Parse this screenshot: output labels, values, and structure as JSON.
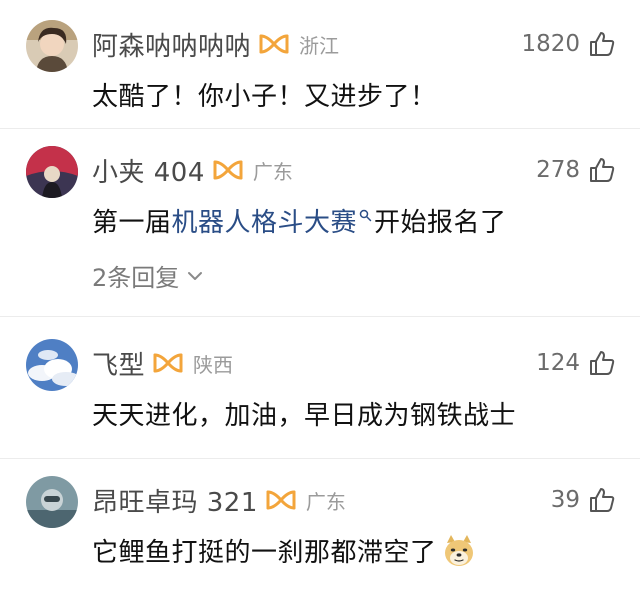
{
  "comments": [
    {
      "username": "阿森呐呐呐呐",
      "region": "浙江",
      "likes": "1820",
      "text": "太酷了！你小子！又进步了！",
      "avatar_icon": "avatar-photo-icon",
      "badge_icon": "vip-badge-icon"
    },
    {
      "username": "小夹 404",
      "region": "广东",
      "likes": "278",
      "text_before": "第一届",
      "link_text": "机器人格斗大赛",
      "text_after": "开始报名了",
      "replies": "2条回复",
      "avatar_icon": "avatar-sunset-icon",
      "badge_icon": "vip-badge-icon"
    },
    {
      "username": "飞型",
      "region": "陕西",
      "likes": "124",
      "text": "天天进化，加油，早日成为钢铁战士",
      "avatar_icon": "avatar-sky-icon",
      "badge_icon": "vip-badge-icon"
    },
    {
      "username": "昂旺卓玛 321",
      "region": "广东",
      "likes": "39",
      "text": "它鲤鱼打挺的一刹那都滞空了",
      "avatar_icon": "avatar-photo-icon",
      "badge_icon": "vip-badge-icon",
      "emoji_icon": "doge-emoji-icon"
    }
  ],
  "colors": {
    "username": "#4a4a4a",
    "region": "#9b9b9b",
    "link": "#2a4d86",
    "badge": "#f3a53b",
    "divider": "#ececec"
  }
}
